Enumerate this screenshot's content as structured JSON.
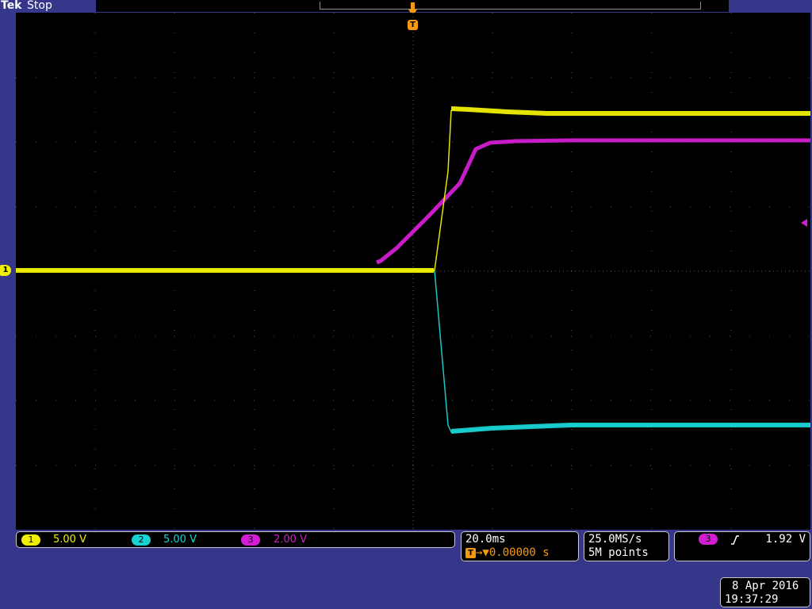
{
  "header": {
    "brand": "Tek",
    "run_state": "Stop"
  },
  "colors": {
    "ch1": "#f0f000",
    "ch2": "#19d2d2",
    "ch3": "#d21ed2",
    "trigger": "#f59a10",
    "frame": "#36378a"
  },
  "markers": {
    "ch1": "1",
    "trigger": "T"
  },
  "channels": [
    {
      "number": "1",
      "scale": "5.00 V"
    },
    {
      "number": "2",
      "scale": "5.00 V"
    },
    {
      "number": "3",
      "scale": "2.00 V"
    }
  ],
  "timebase": {
    "scale": "20.0ms",
    "trigger_position": "0.00000 s"
  },
  "acquisition": {
    "sample_rate": "25.0MS/s",
    "record_length": "5M points"
  },
  "trigger": {
    "source": "3",
    "slope": "rising",
    "level": "1.92 V"
  },
  "datetime": {
    "date": "8 Apr 2016",
    "time": "19:37:29"
  }
}
